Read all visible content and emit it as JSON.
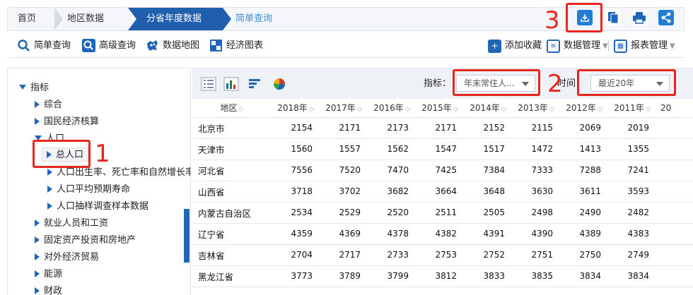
{
  "breadcrumb": {
    "home": "首页",
    "region_data": "地区数据",
    "current": "分省年度数据",
    "query": "简单查询"
  },
  "toolbar": {
    "simple_query": "简单查询",
    "advanced_query": "高级查询",
    "data_map": "数据地图",
    "economic_chart": "经济图表",
    "add_favorite": "添加收藏",
    "data_manage": "数据管理",
    "report_manage": "报表管理"
  },
  "annotations": {
    "one": "1",
    "two": "2",
    "three": "3"
  },
  "tree": {
    "root": "指标",
    "items": [
      "综合",
      "国民经济核算",
      "人口",
      "总人口",
      "人口出生率、死亡率和自然增长率",
      "人口平均预期寿命",
      "人口抽样调查样本数据",
      "就业人员和工资",
      "固定资产投资和房地产",
      "对外经济贸易",
      "能源",
      "财政"
    ]
  },
  "filters": {
    "indicator_label": "指标：",
    "indicator_value": "年末常住人...",
    "time_label": "时间：",
    "time_value": "最近20年"
  },
  "table": {
    "region_header": "地区",
    "years": [
      "2018年",
      "2017年",
      "2016年",
      "2015年",
      "2014年",
      "2013年",
      "2012年",
      "2011年",
      "20"
    ],
    "rows": [
      {
        "region": "北京市",
        "values": [
          "2154",
          "2171",
          "2173",
          "2171",
          "2152",
          "2115",
          "2069",
          "2019"
        ]
      },
      {
        "region": "天津市",
        "values": [
          "1560",
          "1557",
          "1562",
          "1547",
          "1517",
          "1472",
          "1413",
          "1355"
        ]
      },
      {
        "region": "河北省",
        "values": [
          "7556",
          "7520",
          "7470",
          "7425",
          "7384",
          "7333",
          "7288",
          "7241"
        ]
      },
      {
        "region": "山西省",
        "values": [
          "3718",
          "3702",
          "3682",
          "3664",
          "3648",
          "3630",
          "3611",
          "3593"
        ]
      },
      {
        "region": "内蒙古自治区",
        "values": [
          "2534",
          "2529",
          "2520",
          "2511",
          "2505",
          "2498",
          "2490",
          "2482"
        ]
      },
      {
        "region": "辽宁省",
        "values": [
          "4359",
          "4369",
          "4378",
          "4382",
          "4391",
          "4390",
          "4389",
          "4383"
        ]
      },
      {
        "region": "吉林省",
        "values": [
          "2704",
          "2717",
          "2733",
          "2753",
          "2752",
          "2751",
          "2750",
          "2749"
        ]
      },
      {
        "region": "黑龙江省",
        "values": [
          "3773",
          "3789",
          "3799",
          "3812",
          "3833",
          "3835",
          "3834",
          "3834"
        ]
      }
    ]
  },
  "colors": {
    "accent": "#1f66b8",
    "active_crumb": "#1f5fae",
    "annotation": "#e8261d",
    "link": "#3d8fd8"
  }
}
